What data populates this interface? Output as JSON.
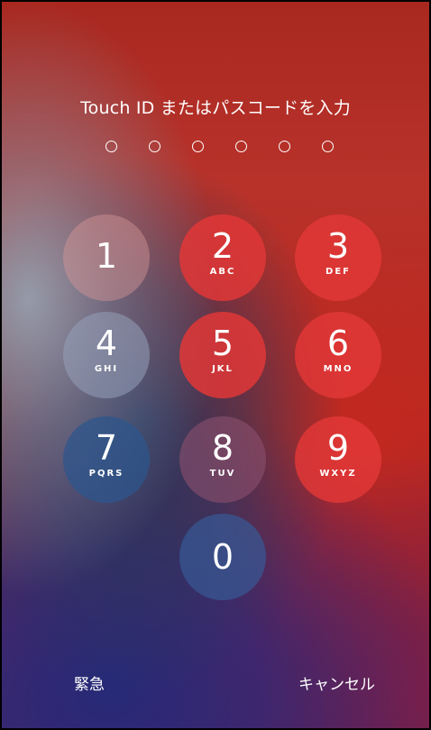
{
  "lock_screen": {
    "prompt": "Touch ID またはパスコードを入力",
    "passcode_length": 6
  },
  "keypad": [
    {
      "digit": "1",
      "letters": ""
    },
    {
      "digit": "2",
      "letters": "ABC"
    },
    {
      "digit": "3",
      "letters": "DEF"
    },
    {
      "digit": "4",
      "letters": "GHI"
    },
    {
      "digit": "5",
      "letters": "JKL"
    },
    {
      "digit": "6",
      "letters": "MNO"
    },
    {
      "digit": "7",
      "letters": "PQRS"
    },
    {
      "digit": "8",
      "letters": "TUV"
    },
    {
      "digit": "9",
      "letters": "WXYZ"
    },
    {
      "digit": "0",
      "letters": ""
    }
  ],
  "footer": {
    "emergency_label": "緊急",
    "cancel_label": "キャンセル"
  }
}
